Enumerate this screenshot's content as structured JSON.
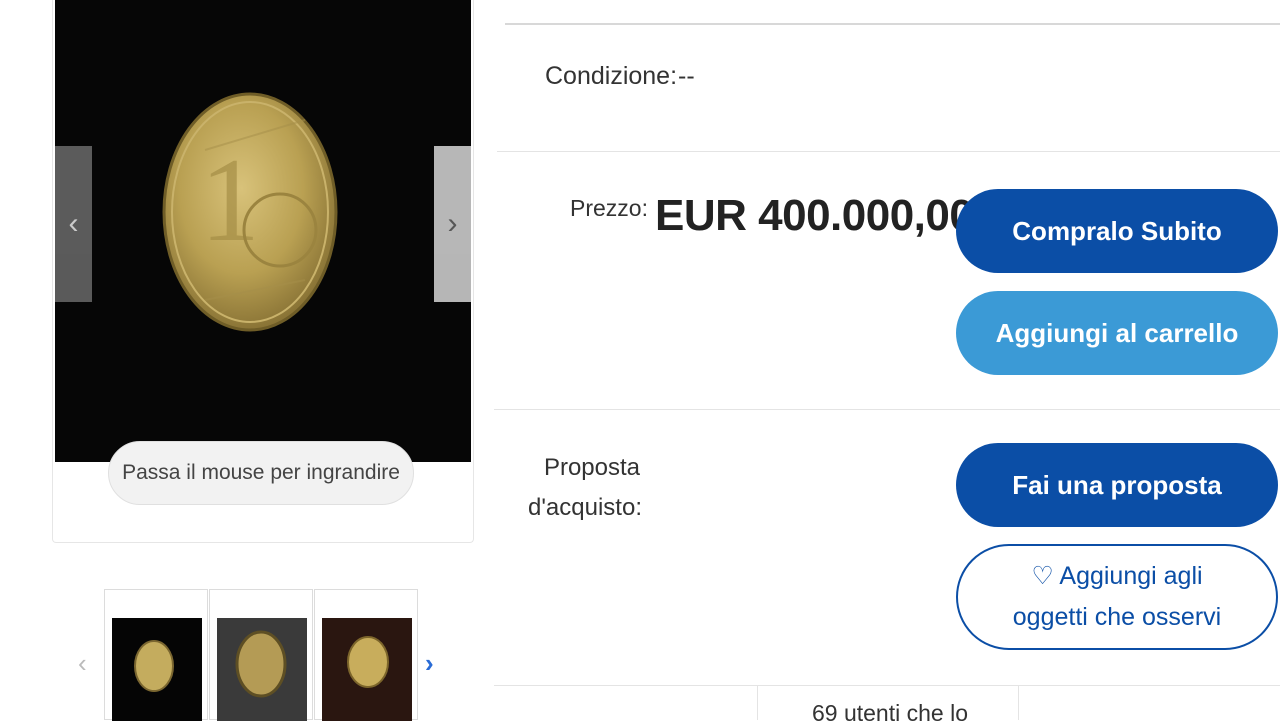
{
  "gallery": {
    "zoom_hint": "Passa il mouse per ingrandire",
    "prev_glyph": "‹",
    "next_glyph": "›",
    "thumb_prev_glyph": "‹",
    "thumb_next_glyph": "›"
  },
  "item": {
    "condition_label": "Condizione:",
    "condition_value": "--",
    "price_label": "Prezzo:",
    "price_value": "EUR 400.000,00",
    "offer_label": "Proposta d'acquisto:"
  },
  "actions": {
    "buy_now": "Compralo Subito",
    "add_to_cart": "Aggiungi al carrello",
    "make_offer": "Fai una proposta",
    "watch_line1": "♡ Aggiungi agli",
    "watch_line2": "oggetti che osservi"
  },
  "stats": {
    "watchers": "69 utenti che lo"
  },
  "colors": {
    "primary_button": "#0b4ea6",
    "secondary_button": "#3b9ad6",
    "link_arrow": "#2a6cd6"
  }
}
